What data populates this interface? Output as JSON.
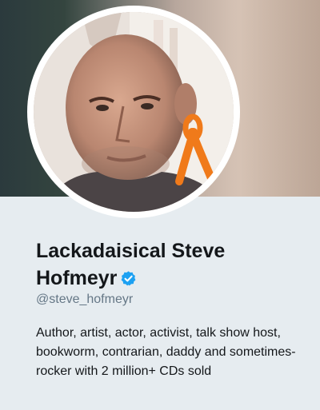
{
  "profile": {
    "display_name_line1": "Lackadaisical Steve",
    "display_name_line2": "Hofmeyr",
    "handle": "@steve_hofmeyr",
    "bio": "Author, artist, actor, activist, talk show host, bookworm, contrarian, daddy and sometimes-rocker with 2 million+ CDs sold",
    "verified": true
  },
  "icons": {
    "verified": "verified-badge-icon",
    "ribbon": "orange-ribbon-icon"
  },
  "colors": {
    "page_background": "#e6ecf0",
    "verified_blue": "#1da1f2",
    "ribbon_orange": "#f07a1a",
    "handle_gray": "#657786",
    "text_dark": "#14171a"
  }
}
